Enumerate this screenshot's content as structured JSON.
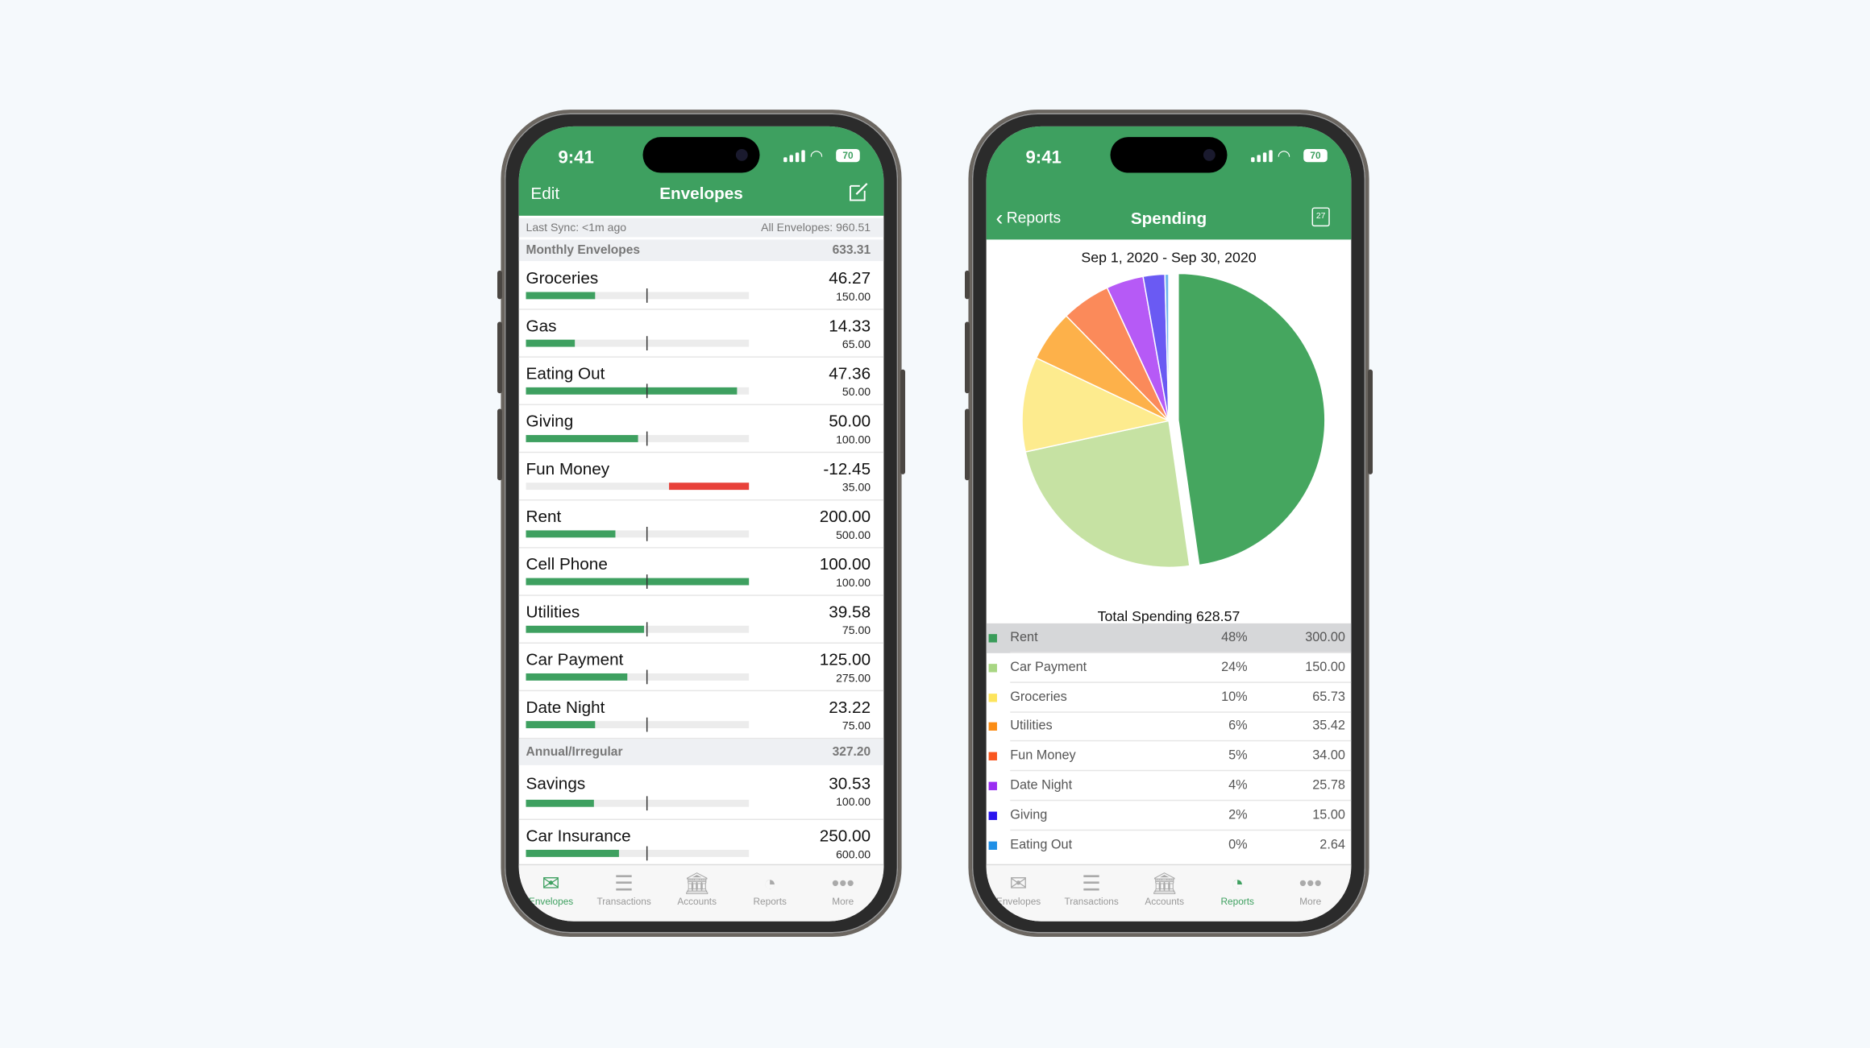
{
  "status": {
    "time": "9:41",
    "battery": "70"
  },
  "envelopes_screen": {
    "edit_label": "Edit",
    "title": "Envelopes",
    "last_sync": "Last Sync: <1m ago",
    "all_envelopes": "All Envelopes: 960.51",
    "month_progress": 0.54,
    "sections": [
      {
        "title": "Monthly Envelopes",
        "total": "633.31",
        "items": [
          {
            "name": "Groceries",
            "balance": "46.27",
            "budget": "150.00"
          },
          {
            "name": "Gas",
            "balance": "14.33",
            "budget": "65.00"
          },
          {
            "name": "Eating Out",
            "balance": "47.36",
            "budget": "50.00"
          },
          {
            "name": "Giving",
            "balance": "50.00",
            "budget": "100.00"
          },
          {
            "name": "Fun Money",
            "balance": "-12.45",
            "budget": "35.00"
          },
          {
            "name": "Rent",
            "balance": "200.00",
            "budget": "500.00"
          },
          {
            "name": "Cell Phone",
            "balance": "100.00",
            "budget": "100.00"
          },
          {
            "name": "Utilities",
            "balance": "39.58",
            "budget": "75.00"
          },
          {
            "name": "Car Payment",
            "balance": "125.00",
            "budget": "275.00"
          },
          {
            "name": "Date Night",
            "balance": "23.22",
            "budget": "75.00"
          }
        ]
      },
      {
        "title": "Annual/Irregular",
        "total": "327.20",
        "items": [
          {
            "name": "Savings",
            "balance": "30.53",
            "budget": "100.00"
          },
          {
            "name": "Car Insurance",
            "balance": "250.00",
            "budget": "600.00"
          }
        ]
      }
    ]
  },
  "spending_screen": {
    "back_label": "Reports",
    "title": "Spending",
    "calendar_day": "27",
    "date_range": "Sep 1, 2020 - Sep 30, 2020",
    "total": "Total Spending 628.57"
  },
  "chart_data": {
    "type": "pie",
    "slices": [
      {
        "name": "Rent",
        "percent": "48%",
        "value": 300.0,
        "amount": "300.00",
        "color": "#3a9c5a",
        "pie_color": "#45a65f"
      },
      {
        "name": "Car Payment",
        "percent": "24%",
        "value": 150.0,
        "amount": "150.00",
        "color": "#a8d683",
        "pie_color": "#c6e2a3"
      },
      {
        "name": "Groceries",
        "percent": "10%",
        "value": 65.73,
        "amount": "65.73",
        "color": "#fde45c",
        "pie_color": "#fdeb8e"
      },
      {
        "name": "Utilities",
        "percent": "6%",
        "value": 35.42,
        "amount": "35.42",
        "color": "#fb8c14",
        "pie_color": "#fdb14a"
      },
      {
        "name": "Fun Money",
        "percent": "5%",
        "value": 34.0,
        "amount": "34.00",
        "color": "#f9561f",
        "pie_color": "#fb8a5a"
      },
      {
        "name": "Date Night",
        "percent": "4%",
        "value": 25.78,
        "amount": "25.78",
        "color": "#9a2df2",
        "pie_color": "#b65af6"
      },
      {
        "name": "Giving",
        "percent": "2%",
        "value": 15.0,
        "amount": "15.00",
        "color": "#2a14ee",
        "pie_color": "#6a5af3"
      },
      {
        "name": "Eating Out",
        "percent": "0%",
        "value": 2.64,
        "amount": "2.64",
        "color": "#1f8fe6",
        "pie_color": "#6fb4f0"
      }
    ],
    "highlighted": "Rent"
  },
  "tabs": [
    {
      "label": "Envelopes",
      "icon": "envelopes-icon"
    },
    {
      "label": "Transactions",
      "icon": "list-icon"
    },
    {
      "label": "Accounts",
      "icon": "bank-icon"
    },
    {
      "label": "Reports",
      "icon": "pie-clock-icon"
    },
    {
      "label": "More",
      "icon": "more-dots-icon"
    }
  ],
  "colors": {
    "brand_green": "#3ea060",
    "negative_red": "#e8413a"
  }
}
